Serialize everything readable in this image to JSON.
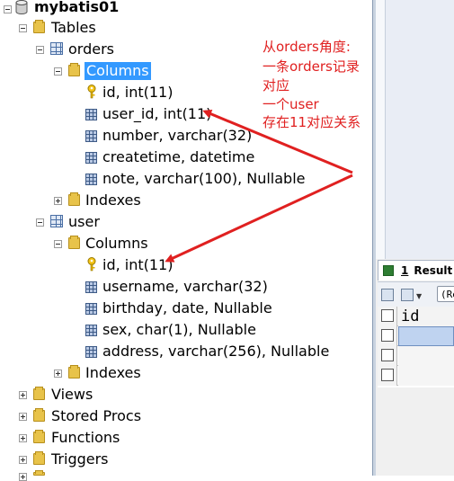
{
  "tree": {
    "database": "mybatis01",
    "tables_label": "Tables",
    "orders": {
      "name": "orders",
      "columns_label": "Columns",
      "columns": [
        {
          "label": "id, int(11)",
          "kind": "key"
        },
        {
          "label": "user_id, int(11)",
          "kind": "column"
        },
        {
          "label": "number, varchar(32)",
          "kind": "column"
        },
        {
          "label": "createtime, datetime",
          "kind": "column"
        },
        {
          "label": "note, varchar(100), Nullable",
          "kind": "column"
        }
      ],
      "indexes_label": "Indexes"
    },
    "user": {
      "name": "user",
      "columns_label": "Columns",
      "columns": [
        {
          "label": "id, int(11)",
          "kind": "key"
        },
        {
          "label": "username, varchar(32)",
          "kind": "column"
        },
        {
          "label": "birthday, date, Nullable",
          "kind": "column"
        },
        {
          "label": "sex, char(1), Nullable",
          "kind": "column"
        },
        {
          "label": "address, varchar(256), Nullable",
          "kind": "column"
        }
      ],
      "indexes_label": "Indexes"
    },
    "other_folders": [
      "Views",
      "Stored Procs",
      "Functions",
      "Triggers"
    ]
  },
  "annotation": {
    "lines": [
      "从orders角度:",
      "一条orders记录",
      "对应",
      "一个user",
      "存在11对应关系"
    ],
    "color": "#e02020"
  },
  "results": {
    "tab_number": "1",
    "tab_label": "Result",
    "toolbar_field": "(Re",
    "grid_header": "id"
  },
  "colors": {
    "selection": "#3399ff",
    "folder": "#e8c34a",
    "arrow": "#e02020"
  }
}
